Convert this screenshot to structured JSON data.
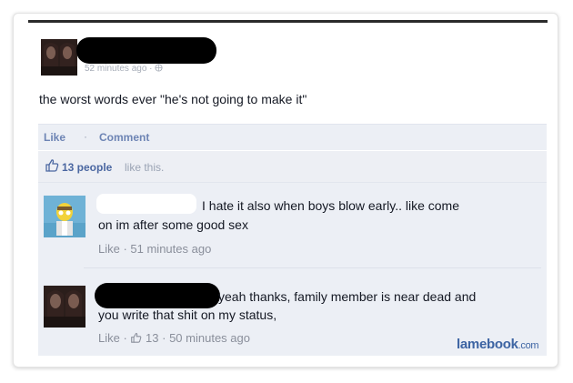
{
  "post": {
    "timestamp": "52 minutes ago",
    "text": "the worst words ever \"he's not going to make it\"",
    "like_label": "Like",
    "separator": "·",
    "comment_label": "Comment"
  },
  "likes": {
    "count_label": "13 people",
    "suffix": "like this."
  },
  "comments": [
    {
      "text": "I hate it also when boys blow early.. like come on im after some good sex",
      "line1": "I hate it also when boys blow early.. like come",
      "line2": "on im after some good sex",
      "meta": "Like · 51 minutes ago"
    },
    {
      "text": "yeah thanks, family member is near dead and you write that shit on my status,",
      "line1": "yeah thanks, family member is near dead and",
      "line2": "you write that shit on my status,",
      "like_label": "Like ·",
      "like_count": "13",
      "time": "· 50 minutes ago"
    }
  ],
  "watermark": {
    "name": "lamebook",
    "tld": ".com"
  },
  "colors": {
    "link": "#6d84b4",
    "like_count": "#4b67a1",
    "comment_bg": "#eceff5",
    "watermark": "#3d64a3"
  },
  "icons": [
    "globe-icon",
    "thumbs-up-icon"
  ]
}
